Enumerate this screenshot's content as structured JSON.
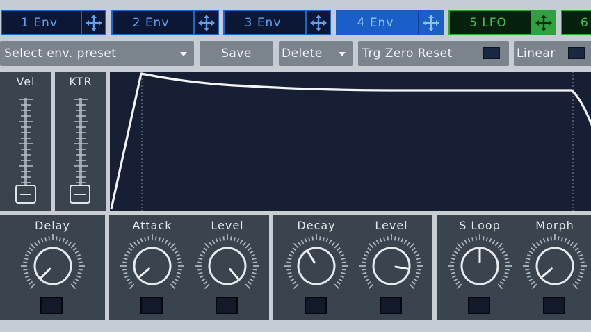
{
  "tabs": [
    {
      "label": "1 Env",
      "style": "normal"
    },
    {
      "label": "2 Env",
      "style": "normal"
    },
    {
      "label": "3 Env",
      "style": "normal"
    },
    {
      "label": "4 Env",
      "style": "active"
    },
    {
      "label": "5 LFO",
      "style": "lfo"
    },
    {
      "label": "6",
      "style": "lfo"
    }
  ],
  "toolbar": {
    "preset_label": "Select env. preset",
    "save_label": "Save",
    "delete_label": "Delete",
    "trg_zero_reset_label": "Trg Zero Reset",
    "linear_label": "Linear"
  },
  "sliders": {
    "vel_label": "Vel",
    "ktr_label": "KTR"
  },
  "knobs": {
    "delay": {
      "label": "Delay",
      "angle": -135
    },
    "attack": {
      "label": "Attack",
      "angle": -130
    },
    "attack_level": {
      "label": "Level",
      "angle": 140
    },
    "decay": {
      "label": "Decay",
      "angle": -30
    },
    "decay_level": {
      "label": "Level",
      "angle": 100
    },
    "s_loop": {
      "label": "S Loop",
      "angle": 0
    },
    "morph": {
      "label": "Morph",
      "angle": -130
    }
  },
  "colors": {
    "tab_blue": "#1f64c8",
    "tab_green": "#2ea33c",
    "panel": "#3a444f",
    "display_bg": "#161f34"
  }
}
